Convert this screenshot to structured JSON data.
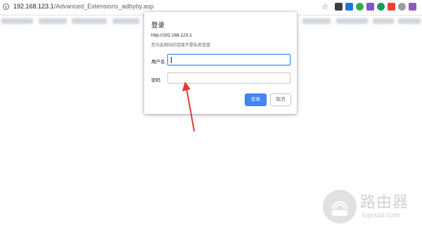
{
  "browser": {
    "url_host": "192.168.123.1",
    "url_path": "/Advanced_Extensions_adbyby.asp"
  },
  "dialog": {
    "title": "登录",
    "origin": "http://192.168.123.1",
    "warning": "您与此网站的连接不是私密连接",
    "username_label": "用户名",
    "username_value": "",
    "password_label": "密码",
    "password_value": "",
    "login_button": "登录",
    "cancel_button": "取消"
  },
  "watermark": {
    "text": "路由器",
    "domain": "luyouqi.com"
  },
  "colors": {
    "accent": "#4285f4",
    "arrow": "#e53935"
  }
}
